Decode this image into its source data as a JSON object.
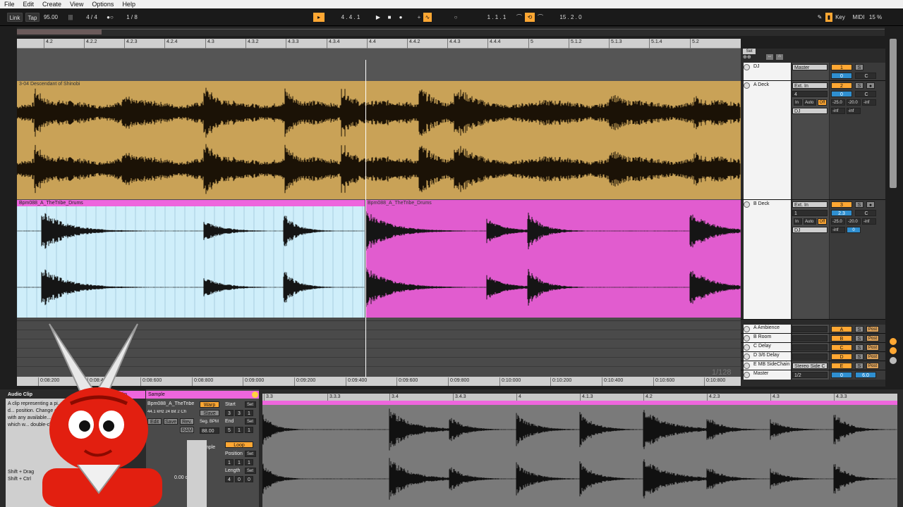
{
  "menu": [
    "File",
    "Edit",
    "Create",
    "View",
    "Options",
    "Help"
  ],
  "transport": {
    "link": "Link",
    "tap": "Tap",
    "tempo": "95.00",
    "signature": "4 / 4",
    "quantize": "1 / 8",
    "position": "4 . 4 . 1",
    "loop_start": "1 . 1 . 1",
    "loop_length": "15 . 2 . 0",
    "key": "Key",
    "midi": "MIDI",
    "cpu": "15 %"
  },
  "ruler_ticks": [
    "4.2",
    "4.2.2",
    "4.2.3",
    "4.2.4",
    "4.3",
    "4.3.2",
    "4.3.3",
    "4.3.4",
    "4.4",
    "4.4.2",
    "4.4.3",
    "4.4.4",
    "5",
    "5.1.2",
    "5.1.3",
    "5.1.4",
    "5.2"
  ],
  "time_ticks": [
    "0:08:200",
    "0:08:400",
    "0:08:600",
    "0:08:800",
    "0:09:000",
    "0:09:200",
    "0:09:400",
    "0:09:600",
    "0:09:800",
    "0:10:000",
    "0:10:200",
    "0:10:400",
    "0:10:600",
    "0:10:800"
  ],
  "zoom_label": "1/128",
  "set_label": "Set",
  "clips": {
    "a_deck": "3-04 Descendant of Shinobi",
    "b_deck_left": "Bpm088_A_TheTribe_Drums",
    "b_deck_right": "Bpm088_A_TheTribe_Drums"
  },
  "tracks": [
    {
      "name": "DJ",
      "io1": "Master",
      "num": "1",
      "vol": "0",
      "pan": "C"
    },
    {
      "name": "A Deck",
      "io1": "Ext. In",
      "io2": "4",
      "io3": "DJ",
      "num": "2",
      "vol": "0",
      "pan": "C",
      "mon_in": "In",
      "mon_auto": "Auto",
      "mon_off": "Off",
      "peak1": "-25.0",
      "peak2": "-20.0",
      "peak3": "-inf",
      "peak4": "-inf",
      "peak5": "-inf"
    },
    {
      "name": "B Deck",
      "io1": "Ext. In",
      "io2": "1",
      "io3": "DJ",
      "num": "3",
      "vol": "2.3",
      "pan": "C",
      "mon_in": "In",
      "mon_auto": "Auto",
      "mon_off": "Off",
      "peak1": "-25.0",
      "peak2": "-20.0",
      "peak3": "-inf",
      "peak4": "-inf",
      "peak5": "0"
    }
  ],
  "returns": [
    {
      "name": "A Ambience",
      "letter": "A",
      "post": "Post"
    },
    {
      "name": "B Room",
      "letter": "B",
      "post": "Post"
    },
    {
      "name": "C Delay",
      "letter": "C",
      "post": "Post"
    },
    {
      "name": "D 3/6 Delay",
      "letter": "D",
      "post": "Post"
    },
    {
      "name": "E MB SideChain",
      "letter": "E",
      "io": "Stereo Side C",
      "post": "Post"
    }
  ],
  "master": {
    "name": "Master",
    "io": "1/2",
    "vol": "0",
    "peak": "6.0"
  },
  "detail": {
    "clip_title": "Audio Clip",
    "clip_tab": "Clip",
    "sample_tab": "Sample",
    "sample_name": "Bpm088_A_TheTribe",
    "sample_info": "44.1 kHz 24 Bit 2 Ch",
    "warp": "Warp",
    "slave": "Slave",
    "edit": "Edit",
    "save": "Save",
    "rev": "Rev.",
    "ram": "RAM",
    "seg_bpm": "Seg. BPM",
    "bpm_val": "88.00",
    "start": "Start",
    "end": "End",
    "loop": "Loop",
    "position": "Position",
    "length": "Length",
    "set": "Set",
    "start_vals": [
      "3",
      "3",
      "1"
    ],
    "end_vals": [
      "5",
      "1",
      "1"
    ],
    "pos_vals": [
      "1",
      "1",
      "1"
    ],
    "len_vals": [
      "4",
      "0",
      "0"
    ],
    "complex": "Comple",
    "gain": "0.00 dB",
    "info_text": "A clip representing a pi... to select the clip and d... position. Change e... the edges. Select... with any available... Clip properties... View, which w... double-clicki...",
    "shortcut1": "Shift + Drag",
    "shortcut2": "Shift + Ctrl"
  },
  "sample_ruler": [
    "3.3",
    "3.3.3",
    "3.4",
    "3.4.3",
    "4",
    "4.1.3",
    "4.2",
    "4.2.3",
    "4.3",
    "4.3.3"
  ]
}
